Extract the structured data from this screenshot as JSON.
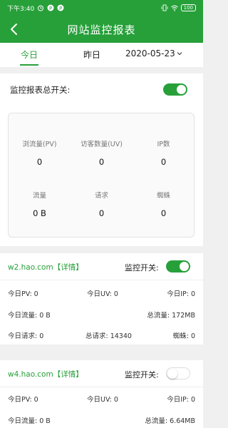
{
  "status_bar": {
    "time": "下午3:40",
    "battery": "100"
  },
  "header": {
    "title": "网站监控报表"
  },
  "tabs": [
    {
      "label": "今日",
      "active": true
    },
    {
      "label": "昨日",
      "active": false
    }
  ],
  "date_select": {
    "value": "2020-05-23"
  },
  "summary": {
    "switch_label": "监控报表总开关:",
    "switch_on": true,
    "stats": [
      {
        "label": "浏流量(PV)",
        "value": "0"
      },
      {
        "label": "访客数量(UV)",
        "value": "0"
      },
      {
        "label": "IP数",
        "value": "0"
      },
      {
        "label": "流量",
        "value": "0 B"
      },
      {
        "label": "请求",
        "value": "0"
      },
      {
        "label": "蜘蛛",
        "value": "0"
      }
    ]
  },
  "sites": [
    {
      "name": "w2.hao.com【详情】",
      "monitor_label": "监控开关:",
      "monitor_on": true,
      "rows": [
        [
          "今日PV: 0",
          "今日UV: 0",
          "今日IP: 0"
        ],
        [
          "今日流量: 0 B",
          "",
          "总流量: 172MB"
        ],
        [
          "今日请求: 0",
          "总请求: 14340",
          "蜘蛛: 0"
        ]
      ]
    },
    {
      "name": "w4.hao.com【详情】",
      "monitor_label": "监控开关:",
      "monitor_on": false,
      "rows": [
        [
          "今日PV: 0",
          "今日UV: 0",
          "今日IP: 0"
        ],
        [
          "今日流量: 0 B",
          "",
          "总流量: 6.64MB"
        ]
      ]
    }
  ],
  "colors": {
    "accent": "#27a03a",
    "background": "#f0f0f0"
  }
}
